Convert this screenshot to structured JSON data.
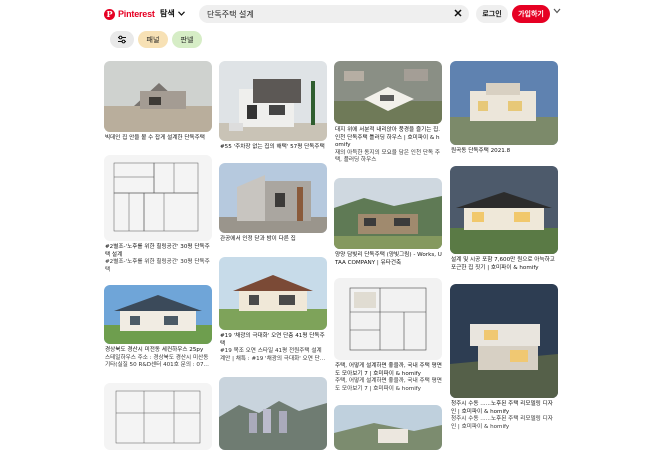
{
  "header": {
    "logo_text": "Pinterest",
    "logo_letter": "P",
    "explore_label": "탐색",
    "search_value": "단독주택 설계",
    "login_label": "로그인",
    "signup_label": "가입하기"
  },
  "filters": {
    "chips": [
      "패널",
      "판넬"
    ]
  },
  "pins": [
    {
      "caption": "빅데인 집 안을 볼 수 잡게 설계한 단독주택"
    },
    {
      "caption": "#2별조-'노후를 위한 힐링공간' 30평 단독주택 설계",
      "sub": "#2별조-'노후를 위한 힐링공간' 30평 단독주택"
    },
    {
      "caption": "경상북도 경산시 미전동 세컨하우스 25py",
      "sub": "스테일하우스 주소 : 경상북도 경산시 미산동 기타(실질 50 R&D센터 401호 문의 : 07..."
    },
    {
      "caption": "#55 '주차장 없는 집의 해택' 57평 단독주택"
    },
    {
      "caption": "관공에서 인정 닫과 밤이 다른 집"
    },
    {
      "caption": "#19 '채광의 극대화' 오연 단층 41평 단독주택",
      "sub": "#19 목조 오연 스타일 41평 전원주택 설계 계안 | 채특 : #19 '채광의 극대화' 오연 단..."
    },
    {
      "caption": "대지 위에 서분적 내리앉아 풍경을 즐기는 집. 인천 단독주택 틀러딩 하우스 | 호미파이 & homify",
      "sub": "재의 아득한 동지의 모요을 담은 인천 단독 주택, 플러딩 하우스"
    },
    {
      "caption": "양양 담빛리 단독주택 (양빛그림) - Works, UTAA COMPANY | 유타건축"
    },
    {
      "caption": "주택, 어떻게 설계하면 좋을까, 국내 주택 평면도 모아보기 7 | 호미파이 & homify",
      "sub": "주택, 어떻게 설계하면 좋을까, 국내 주택 평면도 모아보기 7 | 호미파이 & homify"
    },
    {
      "caption": "원곡동 단독주택 2021.8"
    },
    {
      "caption": "설계 및 시공 포함 7,600만 원으로 아늑하고 포근한 집 짓기 | 호미파이 & homify"
    },
    {
      "caption": "청주시 수동 ......노후된 주택 리모델링 디자인 | 호미파이 & homify",
      "sub": "청주시 수동 ......노후된 주택 리모델링 디자인 | 호미파이 & homify"
    }
  ],
  "colors": {
    "brand": "#e60023",
    "search_bg": "#efefef",
    "chip_panel": "#f7e1b5",
    "chip_pannel": "#d6edc6"
  }
}
